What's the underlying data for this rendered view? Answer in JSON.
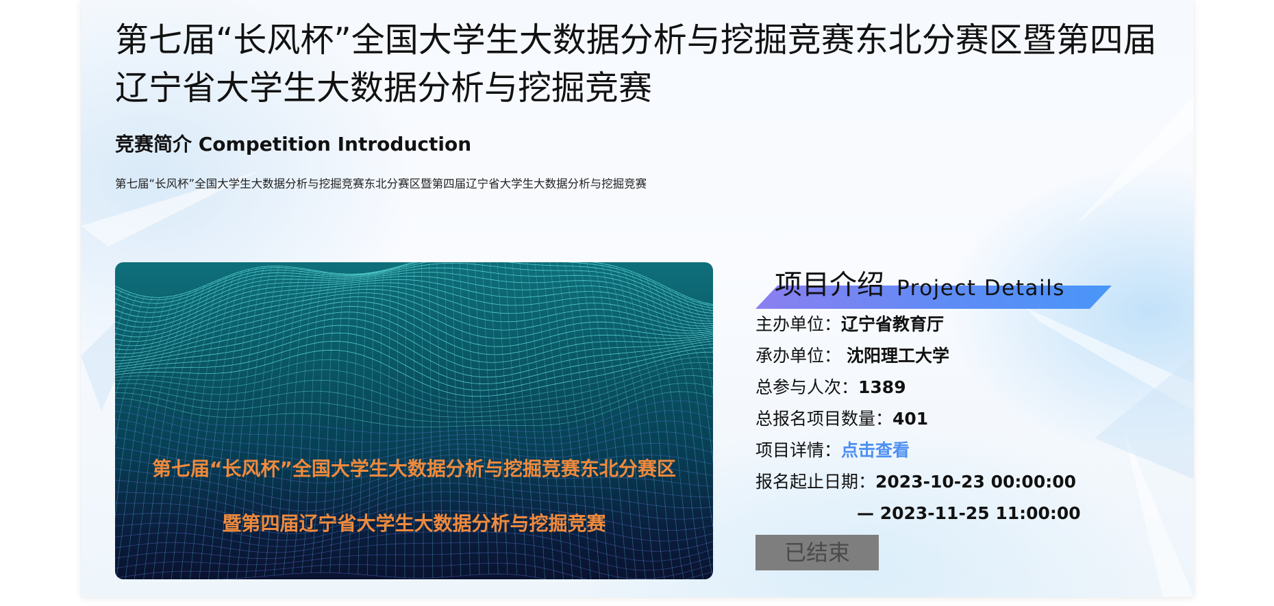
{
  "page": {
    "title": "第七届“长风杯”全国大学生大数据分析与挖掘竞赛东北分赛区暨第四届辽宁省大学生大数据分析与挖掘竞赛",
    "intro_heading": "竞赛简介 Competition Introduction",
    "intro_text": "第七届“长风杯”全国大学生大数据分析与挖掘竞赛东北分赛区暨第四届辽宁省大学生大数据分析与挖掘竞赛"
  },
  "banner": {
    "line1": "第七届“长风杯”全国大学生大数据分析与挖掘竞赛东北分赛区",
    "line2": "暨第四届辽宁省大学生大数据分析与挖掘竞赛"
  },
  "details": {
    "heading_cn": "项目介绍",
    "heading_en": "Project Details",
    "host_label": "主办单位：",
    "host_value": "辽宁省教育厅",
    "organizer_label": "承办单位：",
    "organizer_value": "沈阳理工大学",
    "participants_label": "总参与人次：",
    "participants_value": "1389",
    "projects_label": "总报名项目数量：",
    "projects_value": "401",
    "detail_label": "项目详情：",
    "detail_link": "点击查看",
    "date_label": "报名起止日期：",
    "date_start": "2023-10-23 00:00:00",
    "date_end": "— 2023-11-25 11:00:00",
    "status_button": "已结束"
  },
  "colors": {
    "accent_link": "#4d8ff2",
    "banner_text": "#f08a3c",
    "ribbon_start": "#8b7ff0",
    "ribbon_end": "#4a96f9",
    "status_button_bg": "#7e7e7e"
  }
}
